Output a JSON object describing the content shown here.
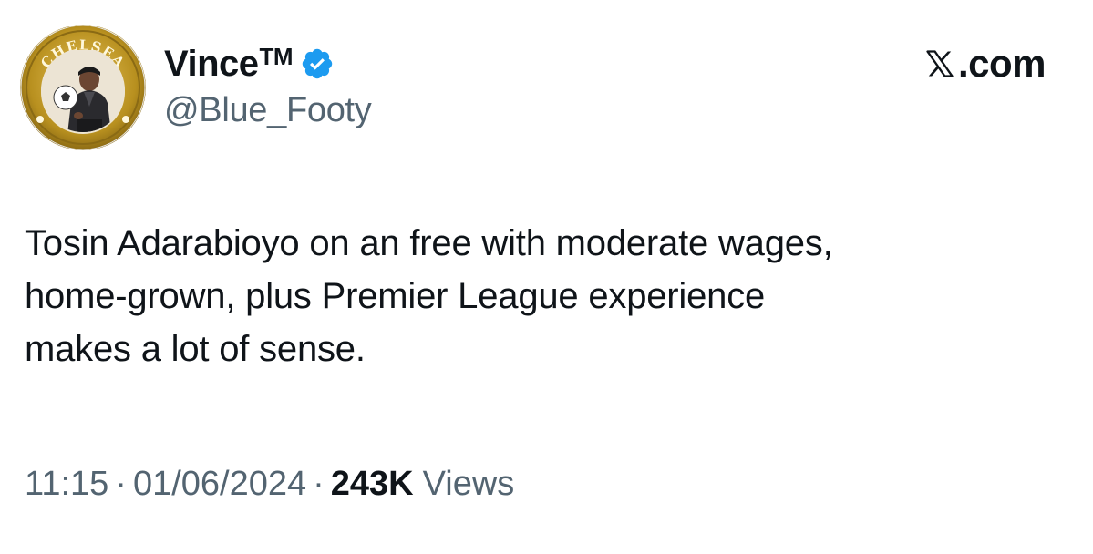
{
  "author": {
    "display_name": "VinceTM",
    "handle": "@Blue_Footy",
    "verified": true,
    "avatar_badge_text": "CHELSEA",
    "avatar_icon": "chelsea-crest-avatar",
    "verified_icon": "verified-badge-icon"
  },
  "brand": {
    "logo_icon": "x-logo-icon",
    "text": ".com"
  },
  "tweet": {
    "lines": [
      "Tosin Adarabioyo on an free with moderate wages,",
      "home-grown, plus Premier League experience",
      "makes a lot of sense."
    ]
  },
  "meta": {
    "time": "11:15",
    "separator": "·",
    "date": "01/06/2024",
    "views_count": "243K",
    "views_label": "Views"
  },
  "colors": {
    "text_primary": "#0f1419",
    "text_secondary": "#536471",
    "verified_blue": "#1d9bf0",
    "crest_gold": "#c9a227",
    "crest_blue": "#1f3d8a"
  }
}
